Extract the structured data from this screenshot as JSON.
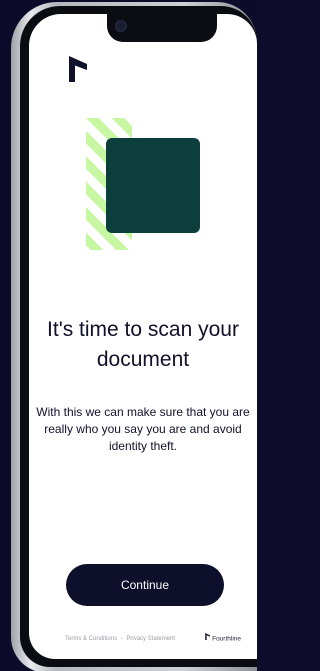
{
  "screen": {
    "title": "It's time to scan your document",
    "subtitle": "With this we can make sure that you are really who you say you are and avoid identity theft.",
    "primary_action": "Continue"
  },
  "footer": {
    "terms_label": "Terms & Conditions",
    "separator": "-",
    "privacy_label": "Privacy Statement",
    "brand_name": "Fourthline"
  },
  "colors": {
    "background": "#0c0c2a",
    "primary": "#0e0f2b",
    "accent_green": "#c8f7a4",
    "card_green": "#0c3f3c",
    "screen_bg": "#ffffff"
  },
  "icons": {
    "logo": "fourthline-logo-icon",
    "illustration": "document-scan-illustration"
  }
}
